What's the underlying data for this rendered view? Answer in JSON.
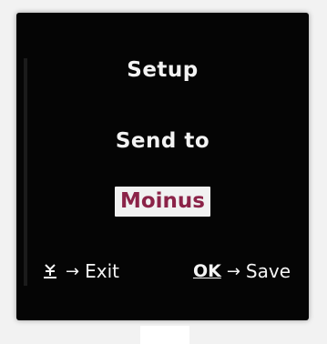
{
  "screen": {
    "title": "Setup",
    "subtitle": "Send to",
    "selected_item": "Moinus",
    "footer": {
      "left_action_icon": "menu-key-icon",
      "left_arrow": "→",
      "left_label": "Exit",
      "right_key": "OK",
      "right_arrow": "→",
      "right_label": "Save"
    }
  },
  "colors": {
    "screen_background": "#050505",
    "text": "#f3f3f3",
    "selection_background": "#f1f1f1",
    "selection_text": "#8b2348"
  }
}
